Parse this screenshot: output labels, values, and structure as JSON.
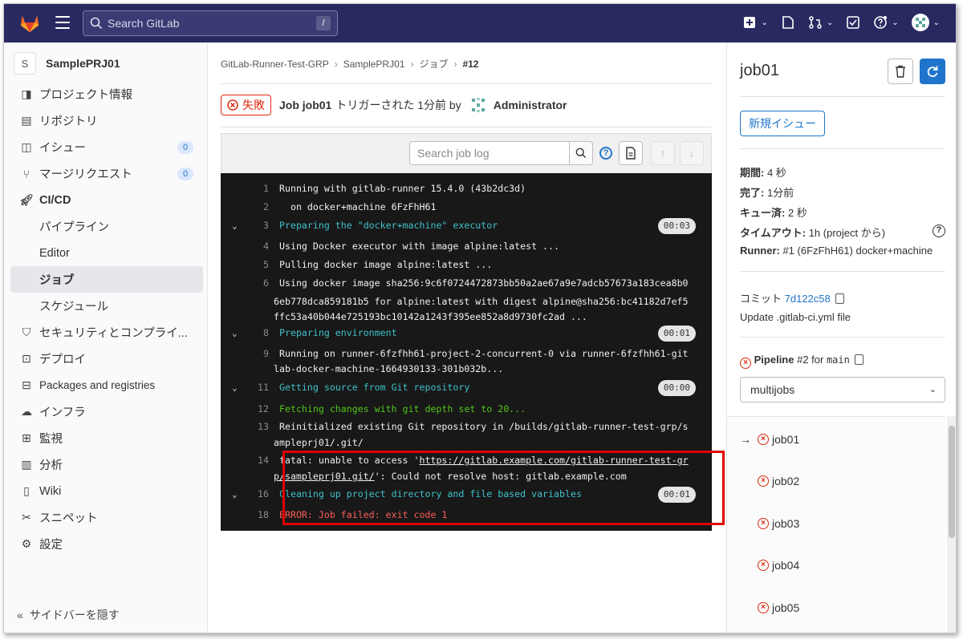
{
  "topbar": {
    "search_placeholder": "Search GitLab",
    "search_shortcut": "/"
  },
  "sidebar": {
    "project_initial": "S",
    "project_name": "SamplePRJ01",
    "items": [
      {
        "label": "プロジェクト情報",
        "icon": "project-info-icon"
      },
      {
        "label": "リポジトリ",
        "icon": "repository-icon"
      },
      {
        "label": "イシュー",
        "icon": "issues-icon",
        "badge": "0"
      },
      {
        "label": "マージリクエスト",
        "icon": "merge-request-icon",
        "badge": "0"
      },
      {
        "label": "CI/CD",
        "icon": "rocket-icon"
      },
      {
        "label": "パイプライン",
        "sub": true
      },
      {
        "label": "Editor",
        "sub": true
      },
      {
        "label": "ジョブ",
        "sub": true,
        "active": true
      },
      {
        "label": "スケジュール",
        "sub": true
      },
      {
        "label": "セキュリティとコンプライ...",
        "icon": "shield-icon"
      },
      {
        "label": "デプロイ",
        "icon": "deploy-icon"
      },
      {
        "label": "Packages and registries",
        "icon": "package-icon"
      },
      {
        "label": "インフラ",
        "icon": "cloud-icon"
      },
      {
        "label": "監視",
        "icon": "monitor-icon"
      },
      {
        "label": "分析",
        "icon": "chart-icon"
      },
      {
        "label": "Wiki",
        "icon": "book-icon"
      },
      {
        "label": "スニペット",
        "icon": "scissors-icon"
      },
      {
        "label": "設定",
        "icon": "gear-icon"
      }
    ],
    "collapse_label": "サイドバーを隠す"
  },
  "breadcrumb": [
    "GitLab-Runner-Test-GRP",
    "SamplePRJ01",
    "ジョブ",
    "#12"
  ],
  "job_header": {
    "status": "失敗",
    "job_label": "Job job01",
    "triggered": "トリガーされた 1分前 by",
    "user": "Administrator"
  },
  "log_toolbar": {
    "search_placeholder": "Search job log"
  },
  "log": [
    {
      "num": "1",
      "text": "Running with gitlab-runner 15.4.0 (43b2dc3d)"
    },
    {
      "num": "2",
      "text": "  on docker+machine 6FzFhH61"
    },
    {
      "num": "3",
      "text": "Preparing the \"docker+machine\" executor",
      "section": true,
      "dur": "00:03"
    },
    {
      "num": "4",
      "text": "Using Docker executor with image alpine:latest ..."
    },
    {
      "num": "5",
      "text": "Pulling docker image alpine:latest ..."
    },
    {
      "num": "6",
      "text": "Using docker image sha256:9c6f0724472873bb50a2ae67a9e7adcb57673a183cea8b0",
      "cont": [
        "6eb778dca859181b5 for alpine:latest with digest alpine@sha256:bc41182d7ef5",
        "ffc53a40b044e725193bc10142a1243f395ee852a8d9730fc2ad ..."
      ]
    },
    {
      "num": "8",
      "text": "Preparing environment",
      "section": true,
      "dur": "00:01"
    },
    {
      "num": "9",
      "text": "Running on runner-6fzfhh61-project-2-concurrent-0 via runner-6fzfhh61-git",
      "cont": [
        "lab-docker-machine-1664930133-301b032b..."
      ]
    },
    {
      "num": "11",
      "text": "Getting source from Git repository",
      "section": true,
      "dur": "00:00"
    },
    {
      "num": "12",
      "text": "Fetching changes with git depth set to 20...",
      "green": true
    },
    {
      "num": "13",
      "text": "Reinitialized existing Git repository in /builds/gitlab-runner-test-grp/s",
      "cont": [
        "ampleprj01/.git/"
      ]
    },
    {
      "num": "14",
      "text_pre": "fatal: unable to access '",
      "url1": "https://gitlab.example.com/gitlab-runner-test-gr",
      "url2": "p/sampleprj01.git/",
      "text_post": "': Could not resolve host: gitlab.example.com"
    },
    {
      "num": "16",
      "text": "Cleaning up project directory and file based variables",
      "section": true,
      "dur": "00:01"
    },
    {
      "num": "18",
      "text": "ERROR: Job failed: exit code 1",
      "red": true
    }
  ],
  "right_panel": {
    "title": "job01",
    "new_issue": "新規イシュー",
    "duration_label": "期間:",
    "duration_value": " 4 秒",
    "finished_label": "完了:",
    "finished_value": " 1分前",
    "queued_label": "キュー済:",
    "queued_value": " 2 秒",
    "timeout_label": "タイムアウト:",
    "timeout_value": " 1h (project から)",
    "runner_label": "Runner:",
    "runner_value": " #1 (6FzFhH61) docker+machine",
    "commit_label": "コミット",
    "commit_sha": "7d122c58",
    "commit_message": "Update .gitlab-ci.yml file",
    "pipeline_label": "Pipeline",
    "pipeline_num": " #2 for ",
    "pipeline_ref": "main",
    "stage": "multijobs",
    "jobs": [
      "job01",
      "job02",
      "job03",
      "job04",
      "job05"
    ]
  },
  "colors": {
    "topbar": "#292961",
    "failed": "#dd2b0e",
    "link": "#1f75cb",
    "log_bg": "#181818"
  }
}
